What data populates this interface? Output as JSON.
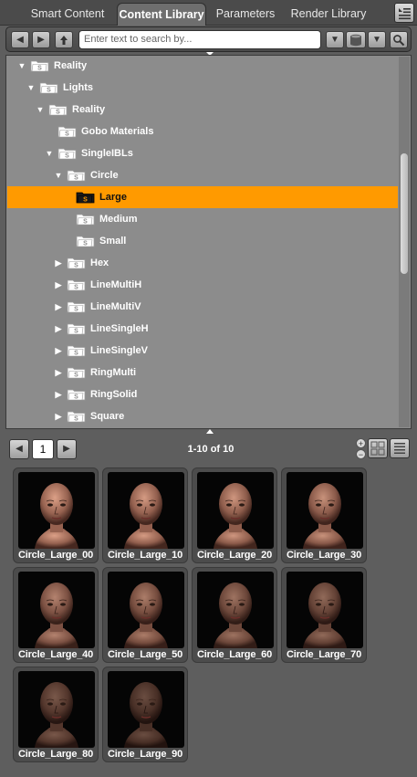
{
  "tabs": [
    {
      "label": "Smart Content",
      "active": false
    },
    {
      "label": "Content Library",
      "active": true
    },
    {
      "label": "Parameters",
      "active": false
    },
    {
      "label": "Render Library",
      "active": false
    }
  ],
  "toolbar": {
    "search_placeholder": "Enter text to search by..."
  },
  "tree": {
    "items": [
      {
        "label": "Reality",
        "depth": 0,
        "expander": "open"
      },
      {
        "label": "Lights",
        "depth": 1,
        "expander": "open"
      },
      {
        "label": "Reality",
        "depth": 2,
        "expander": "open"
      },
      {
        "label": "Gobo Materials",
        "depth": 3,
        "expander": "none"
      },
      {
        "label": "SingleIBLs",
        "depth": 3,
        "expander": "open"
      },
      {
        "label": "Circle",
        "depth": 4,
        "expander": "open"
      },
      {
        "label": "Large",
        "depth": 5,
        "expander": "none",
        "selected": true
      },
      {
        "label": "Medium",
        "depth": 5,
        "expander": "none"
      },
      {
        "label": "Small",
        "depth": 5,
        "expander": "none"
      },
      {
        "label": "Hex",
        "depth": 4,
        "expander": "closed"
      },
      {
        "label": "LineMultiH",
        "depth": 4,
        "expander": "closed"
      },
      {
        "label": "LineMultiV",
        "depth": 4,
        "expander": "closed"
      },
      {
        "label": "LineSingleH",
        "depth": 4,
        "expander": "closed"
      },
      {
        "label": "LineSingleV",
        "depth": 4,
        "expander": "closed"
      },
      {
        "label": "RingMulti",
        "depth": 4,
        "expander": "closed"
      },
      {
        "label": "RingSolid",
        "depth": 4,
        "expander": "closed"
      },
      {
        "label": "Square",
        "depth": 4,
        "expander": "closed"
      }
    ]
  },
  "pager": {
    "current_page": "1",
    "count_text": "1-10 of 10"
  },
  "assets": [
    {
      "name": "Circle_Large_00",
      "brightness": 1.0
    },
    {
      "name": "Circle_Large_10",
      "brightness": 0.97
    },
    {
      "name": "Circle_Large_20",
      "brightness": 0.94
    },
    {
      "name": "Circle_Large_30",
      "brightness": 0.91
    },
    {
      "name": "Circle_Large_40",
      "brightness": 0.82
    },
    {
      "name": "Circle_Large_50",
      "brightness": 0.78
    },
    {
      "name": "Circle_Large_60",
      "brightness": 0.72
    },
    {
      "name": "Circle_Large_70",
      "brightness": 0.66
    },
    {
      "name": "Circle_Large_80",
      "brightness": 0.55
    },
    {
      "name": "Circle_Large_90",
      "brightness": 0.48
    }
  ],
  "colors": {
    "selection": "#ff9a00",
    "tree_bg": "#8c8c8c",
    "panel_bg": "#5e5e5e"
  },
  "icons": {
    "back": "arrow-left-icon",
    "forward": "arrow-right-icon",
    "up": "arrow-up-icon",
    "database": "database-icon",
    "search": "magnifier-icon",
    "menu": "panel-menu-icon",
    "folder": "smart-folder-icon"
  }
}
